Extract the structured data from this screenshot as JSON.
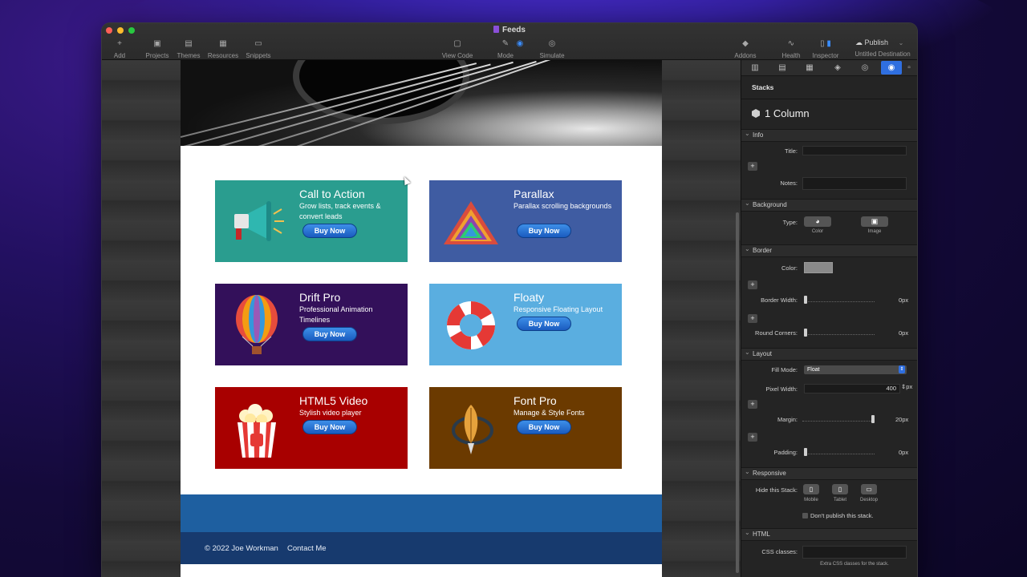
{
  "window": {
    "title": "Feeds"
  },
  "toolbar": {
    "add": "Add",
    "projects": "Projects",
    "themes": "Themes",
    "resources": "Resources",
    "snippets": "Snippets",
    "view_code": "View Code",
    "mode": "Mode",
    "simulate": "Simulate",
    "addons": "Addons",
    "health": "Health",
    "inspector": "Inspector",
    "publish": "Publish",
    "destination": "Untitled Destination"
  },
  "cards": [
    {
      "title": "Call to Action",
      "desc": "Grow lists, track events & convert leads",
      "button": "Buy Now",
      "color": "#2a9d8f",
      "art": "megaphone-icon"
    },
    {
      "title": "Parallax",
      "desc": "Parallax scrolling backgrounds",
      "button": "Buy Now",
      "color": "#3f5ca2",
      "art": "triangle-logo-icon"
    },
    {
      "title": "Drift Pro",
      "desc": "Professional Animation Timelines",
      "button": "Buy Now",
      "color": "#33105a",
      "art": "hot-air-balloon-icon"
    },
    {
      "title": "Floaty",
      "desc": "Responsive Floating Layout",
      "button": "Buy Now",
      "color": "#5aaee0",
      "art": "life-ring-icon"
    },
    {
      "title": "HTML5 Video",
      "desc": "Stylish video player",
      "button": "Buy Now",
      "color": "#a80000",
      "art": "popcorn-icon"
    },
    {
      "title": "Font Pro",
      "desc": "Manage & Style Fonts",
      "button": "Buy Now",
      "color": "#6b3a00",
      "art": "quill-pen-icon"
    }
  ],
  "footer": {
    "copyright": "© 2022 Joe Workman",
    "contact": "Contact Me"
  },
  "inspector": {
    "header": "Stacks",
    "stack_name": "1 Column",
    "sections": {
      "info": "Info",
      "background": "Background",
      "border": "Border",
      "layout": "Layout",
      "responsive": "Responsive",
      "html": "HTML"
    },
    "info": {
      "title_label": "Title:",
      "title_value": "",
      "notes_label": "Notes:",
      "notes_value": ""
    },
    "background": {
      "type_label": "Type:",
      "color_label": "Color",
      "image_label": "Image"
    },
    "border": {
      "color_label": "Color:",
      "width_label": "Border Width:",
      "width_value": "0px",
      "corners_label": "Round Corners:",
      "corners_value": "0px"
    },
    "layout": {
      "fill_mode_label": "Fill Mode:",
      "fill_mode_value": "Float",
      "pixel_width_label": "Pixel Width:",
      "pixel_width_value": "400",
      "pixel_width_unit": "px",
      "margin_label": "Margin:",
      "margin_value": "20px",
      "padding_label": "Padding:",
      "padding_value": "0px"
    },
    "responsive": {
      "hide_label": "Hide this Stack:",
      "mobile": "Mobile",
      "tablet": "Tablet",
      "desktop": "Desktop",
      "no_publish": "Don't publish this stack."
    },
    "html": {
      "css_label": "CSS classes:",
      "css_value": "",
      "css_hint": "Extra CSS classes for the stack."
    }
  }
}
